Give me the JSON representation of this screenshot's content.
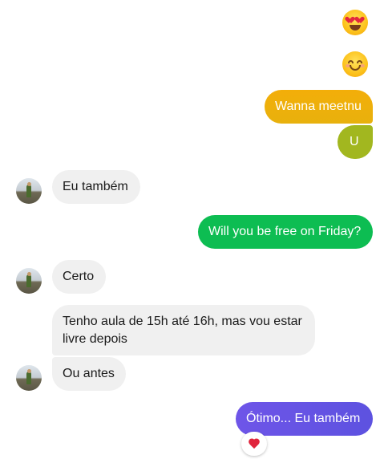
{
  "conversation": {
    "emojis": [
      {
        "icon": "heart-eyes-emoji-icon"
      },
      {
        "icon": "smiling-blush-emoji-icon"
      }
    ],
    "messages": [
      {
        "sender": "me",
        "text": "Wanna meetnu",
        "color": "#f3ae09"
      },
      {
        "sender": "me",
        "text": "U",
        "color": "#a2b71f"
      },
      {
        "sender": "contact",
        "text": "Eu também"
      },
      {
        "sender": "me",
        "text": "Will you be free on Friday?",
        "color": "#0dbd52"
      },
      {
        "sender": "contact",
        "text": "Certo"
      },
      {
        "sender": "contact",
        "text": "Tenho aula de 15h até 16h, mas vou estar livre depois"
      },
      {
        "sender": "contact",
        "text": "Ou antes"
      },
      {
        "sender": "me",
        "text": "Ótimo... Eu também",
        "color": "#6e55e8",
        "reaction": "red-heart-icon"
      }
    ]
  }
}
